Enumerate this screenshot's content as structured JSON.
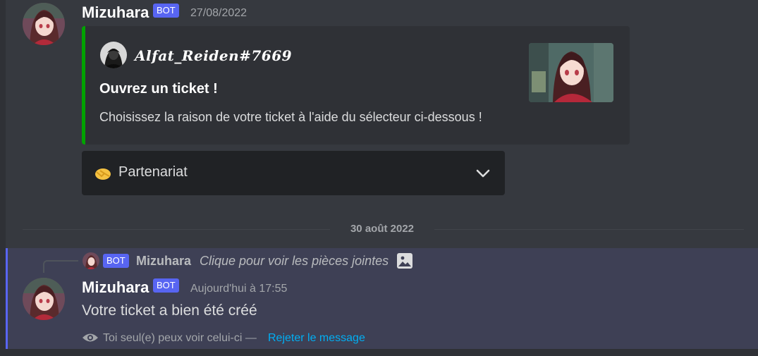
{
  "colors": {
    "background": "#36393f",
    "embed_background": "#2f3136",
    "embed_accent": "#00a300",
    "bot_tag": "#5865f2",
    "highlight_background": "#3e4055",
    "link": "#00aff4"
  },
  "message_1": {
    "author": "Mizuhara",
    "bot_tag": "BOT",
    "timestamp": "27/08/2022",
    "embed": {
      "author_name": "𝑨𝒍𝒇𝒂𝒕_𝑹𝒆𝒊𝒅𝒆𝒏#7669",
      "title": "Ouvrez un ticket !",
      "description": "Choisissez la raison de votre ticket à l'aide du sélecteur ci-dessous !"
    },
    "select_menu": {
      "emoji_icon": "handshake-icon",
      "selected_label": "Partenariat",
      "chevron_icon": "chevron-down-icon"
    }
  },
  "date_divider": "30 août 2022",
  "message_2": {
    "reply": {
      "bot_tag": "BOT",
      "author": "Mizuhara",
      "text": "Clique pour voir les pièces jointes",
      "attachment_icon": "image-icon"
    },
    "author": "Mizuhara",
    "bot_tag": "BOT",
    "timestamp": "Aujourd'hui à 17:55",
    "content": "Votre ticket a bien été créé",
    "ephemeral": {
      "icon": "eye-icon",
      "notice": "Toi seul(e) peux voir celui-ci —",
      "dismiss": "Rejeter le message"
    }
  }
}
